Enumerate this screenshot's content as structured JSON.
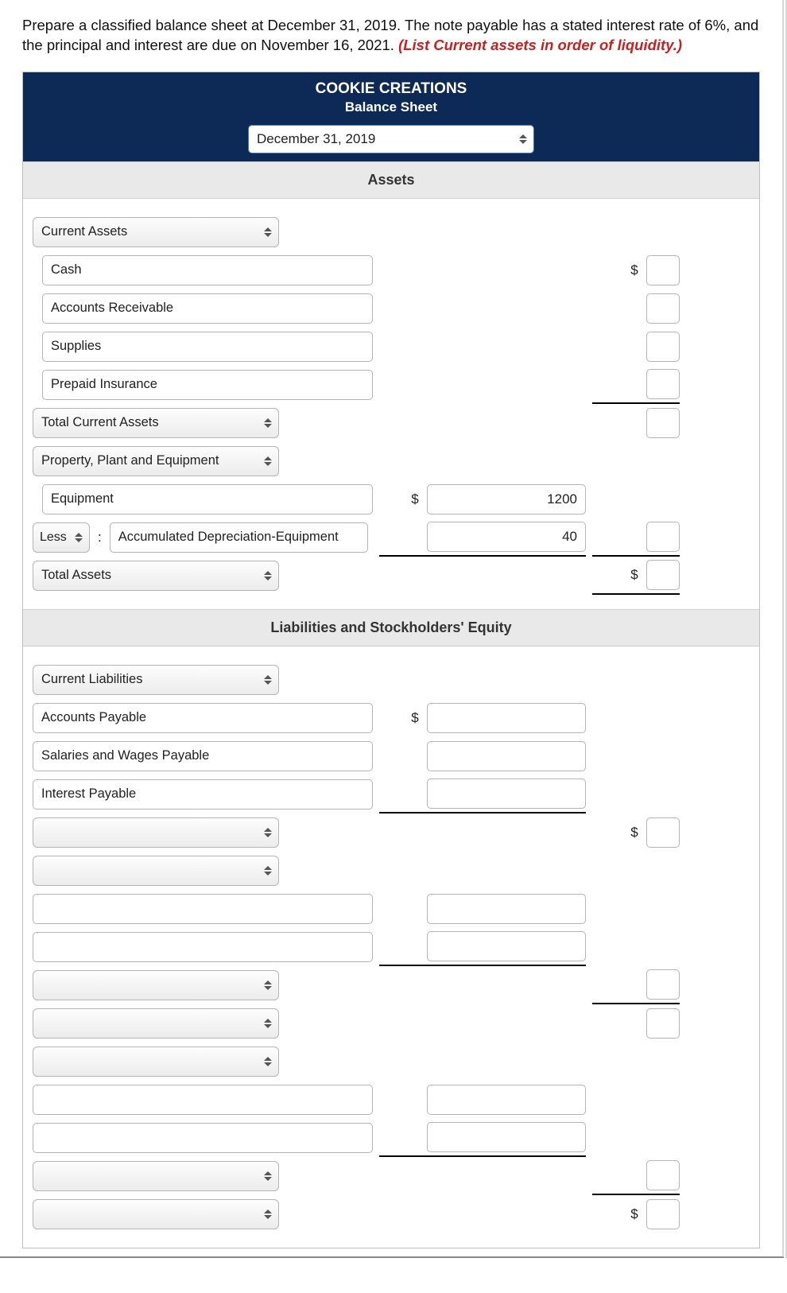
{
  "prompt": {
    "main": "Prepare a classified balance sheet at December 31, 2019. The note payable has a stated interest rate of 6%, and the principal and interest are due on November 16, 2021. ",
    "emph": "(List Current assets in order of liquidity.)"
  },
  "header": {
    "company": "COOKIE CREATIONS",
    "title": "Balance Sheet",
    "date": "December 31, 2019"
  },
  "sections": {
    "assets": "Assets",
    "liab": "Liabilities and Stockholders' Equity"
  },
  "rows": {
    "current_assets": "Current Assets",
    "cash": "Cash",
    "ar": "Accounts Receivable",
    "supplies": "Supplies",
    "prepaid": "Prepaid Insurance",
    "tca": "Total Current Assets",
    "ppe": "Property, Plant and Equipment",
    "equip": "Equipment",
    "less": "Less",
    "accdep": "Accumulated Depreciation-Equipment",
    "ta": "Total Assets",
    "cl": "Current Liabilities",
    "ap": "Accounts Payable",
    "swp": "Salaries and Wages Payable",
    "ip": "Interest Payable"
  },
  "values": {
    "equip": "1200",
    "accdep": "40"
  },
  "sym": {
    "dollar": "$"
  }
}
